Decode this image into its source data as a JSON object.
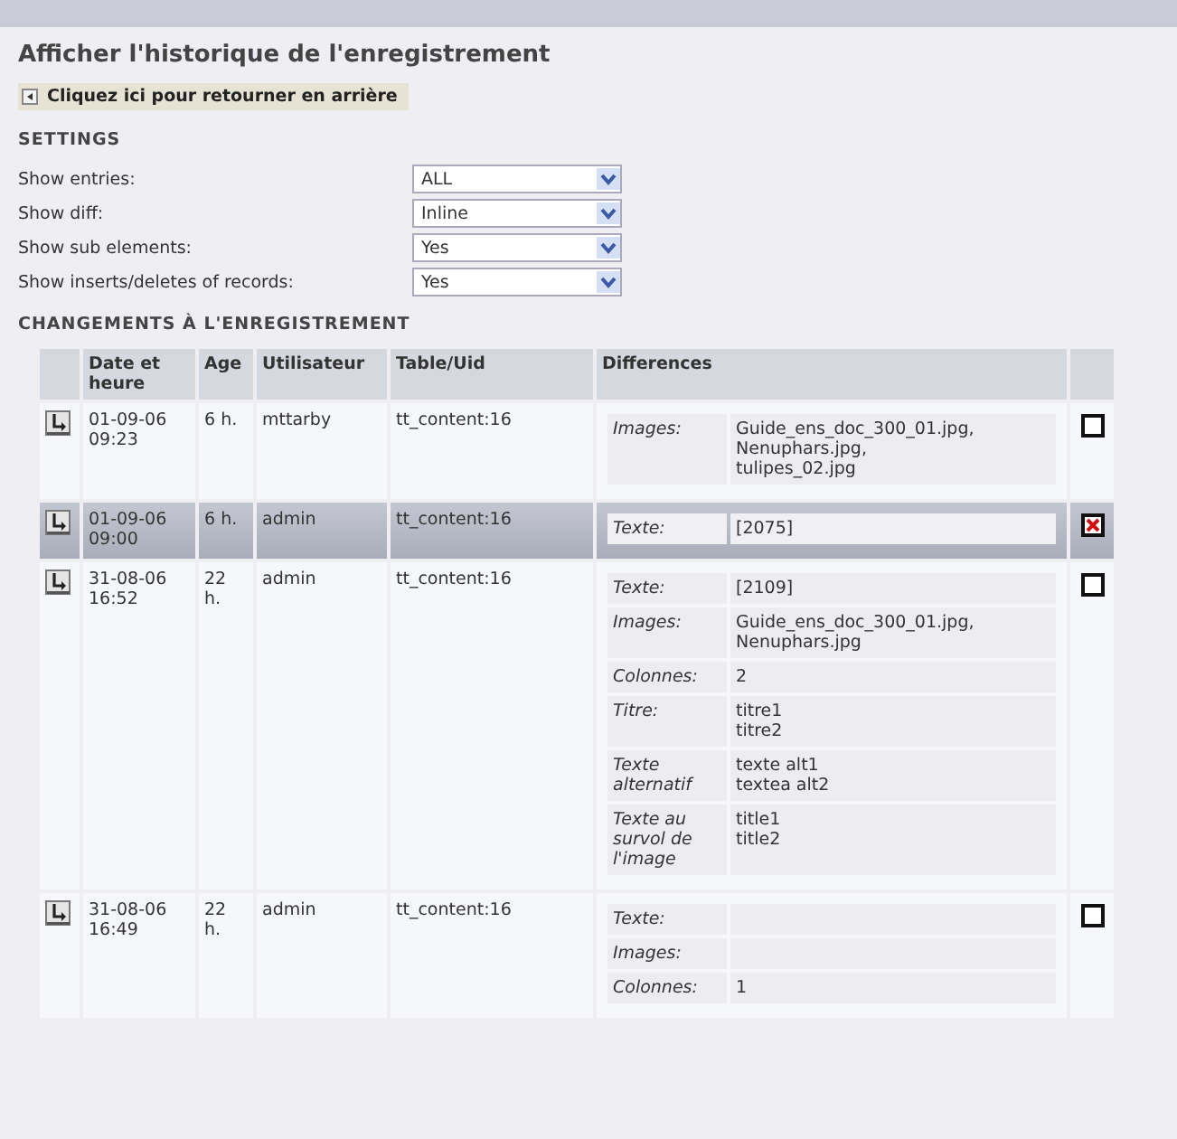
{
  "title": "Afficher l'historique de l'enregistrement",
  "back_link": {
    "label": "Cliquez ici pour retourner en arrière"
  },
  "settings": {
    "heading": "SETTINGS",
    "fields": [
      {
        "label": "Show entries:",
        "value": "ALL"
      },
      {
        "label": "Show diff:",
        "value": "Inline"
      },
      {
        "label": "Show sub elements:",
        "value": "Yes"
      },
      {
        "label": "Show inserts/deletes of records:",
        "value": "Yes"
      }
    ]
  },
  "changes": {
    "heading": "CHANGEMENTS À L'ENREGISTREMENT",
    "columns": [
      "Date et heure",
      "Age",
      "Utilisateur",
      "Table/Uid",
      "Differences"
    ],
    "rows": [
      {
        "date": "01-09-06 09:23",
        "age": "6 h.",
        "user": "mttarby",
        "table_uid": "tt_content:16",
        "selected": false,
        "checked": false,
        "differences": [
          {
            "field": "Images:",
            "value": [
              "Guide_ens_doc_300_01.jpg,",
              "Nenuphars.jpg,",
              "tulipes_02.jpg"
            ]
          }
        ]
      },
      {
        "date": "01-09-06 09:00",
        "age": "6 h.",
        "user": "admin",
        "table_uid": "tt_content:16",
        "selected": true,
        "checked": true,
        "differences": [
          {
            "field": "Texte:",
            "value": [
              "[2075]"
            ]
          }
        ]
      },
      {
        "date": "31-08-06 16:52",
        "age": "22 h.",
        "user": "admin",
        "table_uid": "tt_content:16",
        "selected": false,
        "checked": false,
        "differences": [
          {
            "field": "Texte:",
            "value": [
              "[2109]"
            ]
          },
          {
            "field": "Images:",
            "value": [
              "Guide_ens_doc_300_01.jpg,",
              "Nenuphars.jpg"
            ]
          },
          {
            "field": "Colonnes:",
            "value": [
              "2"
            ]
          },
          {
            "field": "Titre:",
            "value": [
              "titre1",
              "titre2"
            ]
          },
          {
            "field": "Texte alternatif",
            "value": [
              "texte alt1",
              "textea alt2"
            ]
          },
          {
            "field": "Texte au survol de l'image",
            "value": [
              "title1",
              "title2"
            ]
          }
        ]
      },
      {
        "date": "31-08-06 16:49",
        "age": "22 h.",
        "user": "admin",
        "table_uid": "tt_content:16",
        "selected": false,
        "checked": false,
        "differences": [
          {
            "field": "Texte:"
          },
          {
            "field": "Images:"
          },
          {
            "field": "Colonnes:",
            "value": [
              "1"
            ]
          }
        ]
      }
    ]
  }
}
